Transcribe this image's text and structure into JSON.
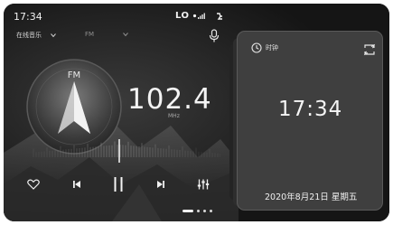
{
  "status_bar": {
    "time": "17:34",
    "lo_label": "LO"
  },
  "radio": {
    "source_label": "在线音乐",
    "band_label": "FM",
    "dial_label": "FM",
    "frequency": "102.4",
    "unit": "MHz"
  },
  "clock_widget": {
    "label": "时钟",
    "time": "17:34",
    "date": "2020年8月21日 星期五"
  },
  "pager": {
    "total": 4,
    "active": 0
  },
  "icons": {
    "mic": "microphone-icon",
    "favorite": "heart-icon",
    "prev": "skip-previous-icon",
    "play_pause": "pause-icon",
    "next": "skip-next-icon",
    "equalizer": "equalizer-icon",
    "clock": "clock-icon",
    "switch": "switch-icon"
  },
  "colors": {
    "background": "#151515",
    "card": "#3f3f3f",
    "text": "#f4f4f4"
  }
}
